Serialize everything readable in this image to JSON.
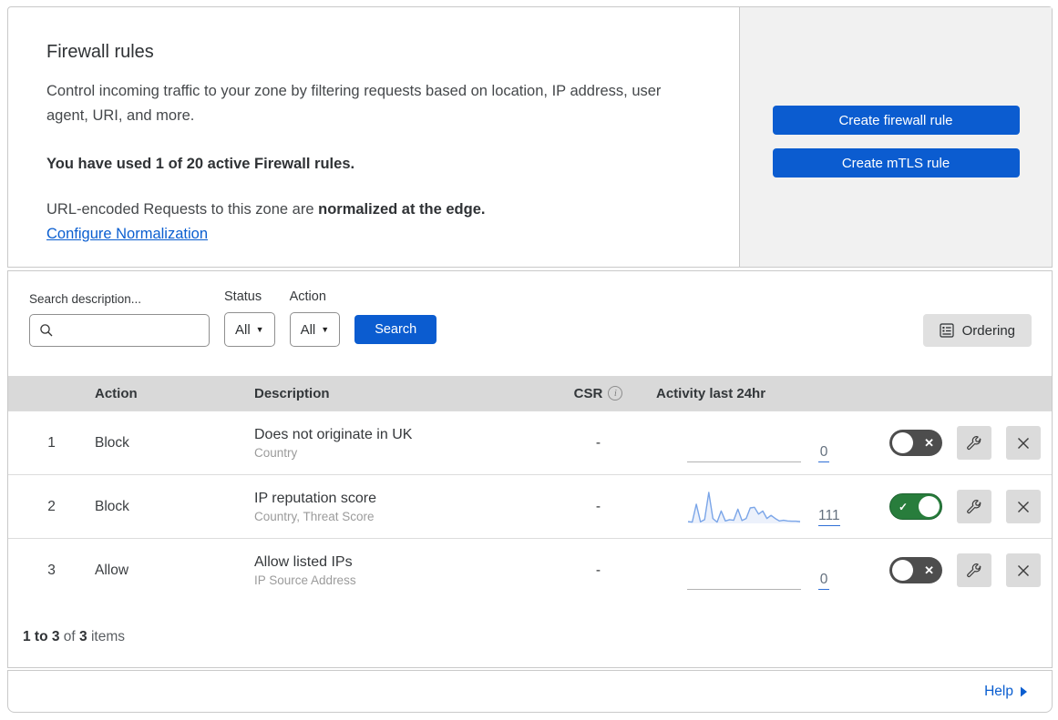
{
  "colors": {
    "accent_blue": "#0b5cd0",
    "link_blue": "#0a5ed0",
    "toggle_on_green": "#287d3c",
    "toggle_off_gray": "#4d4d4d",
    "sparkline_blue": "#7aa5e8",
    "table_header_gray": "#d9d9d9",
    "side_panel_gray": "#f1f1f1"
  },
  "icons": {
    "dropdown_caret": "▼",
    "toggle_off_mark": "✕",
    "toggle_on_mark": "✓",
    "info": "i"
  },
  "intro": {
    "title": "Firewall rules",
    "description": "Control incoming traffic to your zone by filtering requests based on location, IP address, user agent, URI, and more.",
    "usage": "You have used 1 of 20 active Firewall rules.",
    "normalization_prefix": "URL-encoded Requests to this zone are",
    "normalization_bold": "normalized at the edge.",
    "normalization_link": "Configure Normalization",
    "create_firewall_button": "Create firewall rule",
    "create_mtls_button": "Create mTLS rule"
  },
  "filters": {
    "search_label": "Search description...",
    "status_label": "Status",
    "status_value": "All",
    "action_label": "Action",
    "action_value": "All",
    "search_button": "Search",
    "ordering_button": "Ordering"
  },
  "table": {
    "columns": {
      "action": "Action",
      "description": "Description",
      "csr": "CSR",
      "activity": "Activity last 24hr"
    },
    "rows": [
      {
        "priority": "1",
        "action": "Block",
        "description": "Does not originate in UK",
        "fields": "Country",
        "csr": "-",
        "activity_count": "0",
        "enabled": false,
        "sparkline": null
      },
      {
        "priority": "2",
        "action": "Block",
        "description": "IP reputation score",
        "fields": "Country, Threat Score",
        "csr": "-",
        "activity_count": "111",
        "enabled": true,
        "sparkline": [
          6,
          4,
          62,
          5,
          12,
          100,
          16,
          4,
          40,
          8,
          12,
          10,
          46,
          9,
          16,
          50,
          52,
          30,
          40,
          16,
          26,
          16,
          8,
          10,
          8,
          7,
          7,
          6
        ]
      },
      {
        "priority": "3",
        "action": "Allow",
        "description": "Allow listed IPs",
        "fields": "IP Source Address",
        "csr": "-",
        "activity_count": "0",
        "enabled": false,
        "sparkline": null
      }
    ],
    "footer": {
      "range": "1 to 3",
      "of": "of",
      "total": "3",
      "items": "items"
    }
  },
  "help": {
    "label": "Help"
  }
}
